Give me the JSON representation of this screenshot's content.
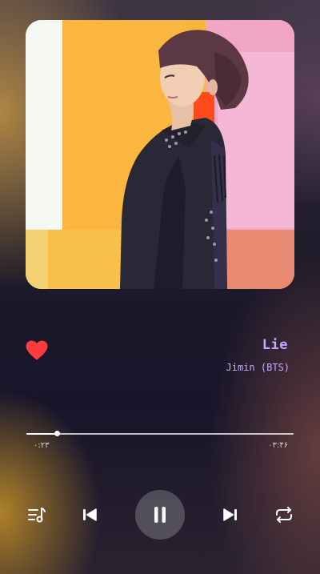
{
  "track": {
    "title": "Lie",
    "artist": "Jimin (BTS)",
    "liked": true
  },
  "progress": {
    "elapsed": "۰:۲۳",
    "total": "۰۳:۴۶",
    "fraction": 0.114
  },
  "controls": {
    "queue_icon": "queue-music-icon",
    "prev_icon": "skip-previous-icon",
    "play_state_icon": "pause-icon",
    "next_icon": "skip-next-icon",
    "repeat_icon": "repeat-icon"
  },
  "colors": {
    "accent_text": "#c8a8ff",
    "like": "#ff3b3b"
  }
}
